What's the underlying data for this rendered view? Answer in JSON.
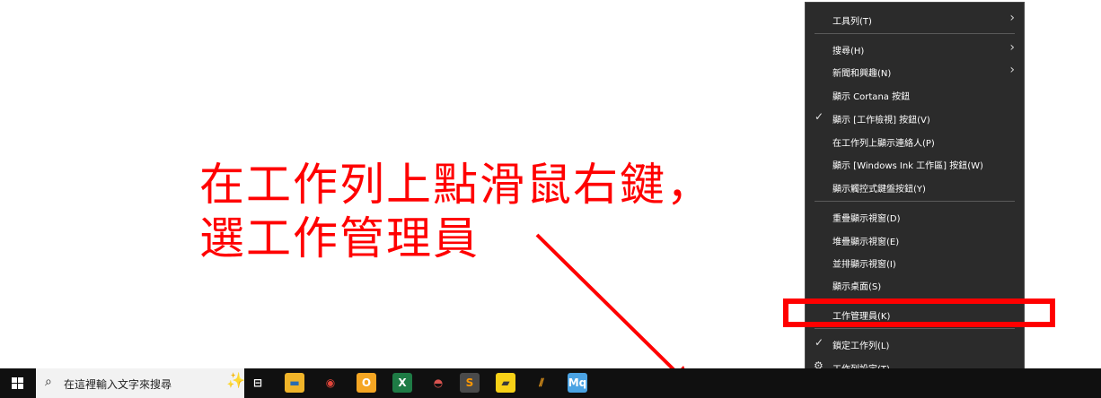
{
  "annotation": {
    "line1": "在工作列上點滑鼠右鍵，",
    "line2": "選工作管理員",
    "color": "#ff0000"
  },
  "context_menu": {
    "items": [
      {
        "label": "工具列(T)",
        "submenu": true
      },
      {
        "label": "搜尋(H)",
        "submenu": true
      },
      {
        "label": "新聞和興趣(N)",
        "submenu": true
      },
      {
        "label": "顯示 Cortana 按鈕"
      },
      {
        "label": "顯示 [工作檢視] 按鈕(V)",
        "checked": true
      },
      {
        "label": "在工作列上顯示連絡人(P)"
      },
      {
        "label": "顯示 [Windows Ink 工作區] 按鈕(W)"
      },
      {
        "label": "顯示觸控式鍵盤按鈕(Y)"
      },
      {
        "label": "重疊顯示視窗(D)"
      },
      {
        "label": "堆疊顯示視窗(E)"
      },
      {
        "label": "並排顯示視窗(I)"
      },
      {
        "label": "顯示桌面(S)"
      },
      {
        "label": "工作管理員(K)",
        "highlighted": true
      },
      {
        "label": "鎖定工作列(L)",
        "checked": true
      },
      {
        "label": "工作列設定(T)",
        "icon": "gear-icon"
      }
    ],
    "chevron": "›",
    "check": "✓",
    "gear": "⚙",
    "highlight_color": "#ff0000"
  },
  "taskbar": {
    "search_placeholder": "在這裡輸入文字來搜尋",
    "search_icon": "⌕",
    "sparkle": "✨",
    "apps": [
      {
        "name": "task-view-icon",
        "glyph": "⊟",
        "bg": "#101010",
        "fg": "#ffffff"
      },
      {
        "name": "file-explorer-icon",
        "glyph": "▬",
        "bg": "#f0b429",
        "fg": "#2b6cb0"
      },
      {
        "name": "chrome-icon",
        "glyph": "◉",
        "bg": "#101010",
        "fg": "#e0453a"
      },
      {
        "name": "outlook-icon",
        "glyph": "O",
        "bg": "#f5a623",
        "fg": "#ffffff"
      },
      {
        "name": "excel-icon",
        "glyph": "X",
        "bg": "#1e7b45",
        "fg": "#ffffff"
      },
      {
        "name": "paint-icon",
        "glyph": "◓",
        "bg": "#101010",
        "fg": "#d9534f"
      },
      {
        "name": "sublime-icon",
        "glyph": "S",
        "bg": "#4a4a4a",
        "fg": "#ff9800"
      },
      {
        "name": "sticky-notes-icon",
        "glyph": "▰",
        "bg": "#f7d117",
        "fg": "#3a3a3a"
      },
      {
        "name": "pen-app-icon",
        "glyph": "⫽",
        "bg": "#101010",
        "fg": "#f7a21b"
      },
      {
        "name": "mq-app-icon",
        "glyph": "Mq",
        "bg": "#4ba3e3",
        "fg": "#ffffff"
      }
    ]
  }
}
